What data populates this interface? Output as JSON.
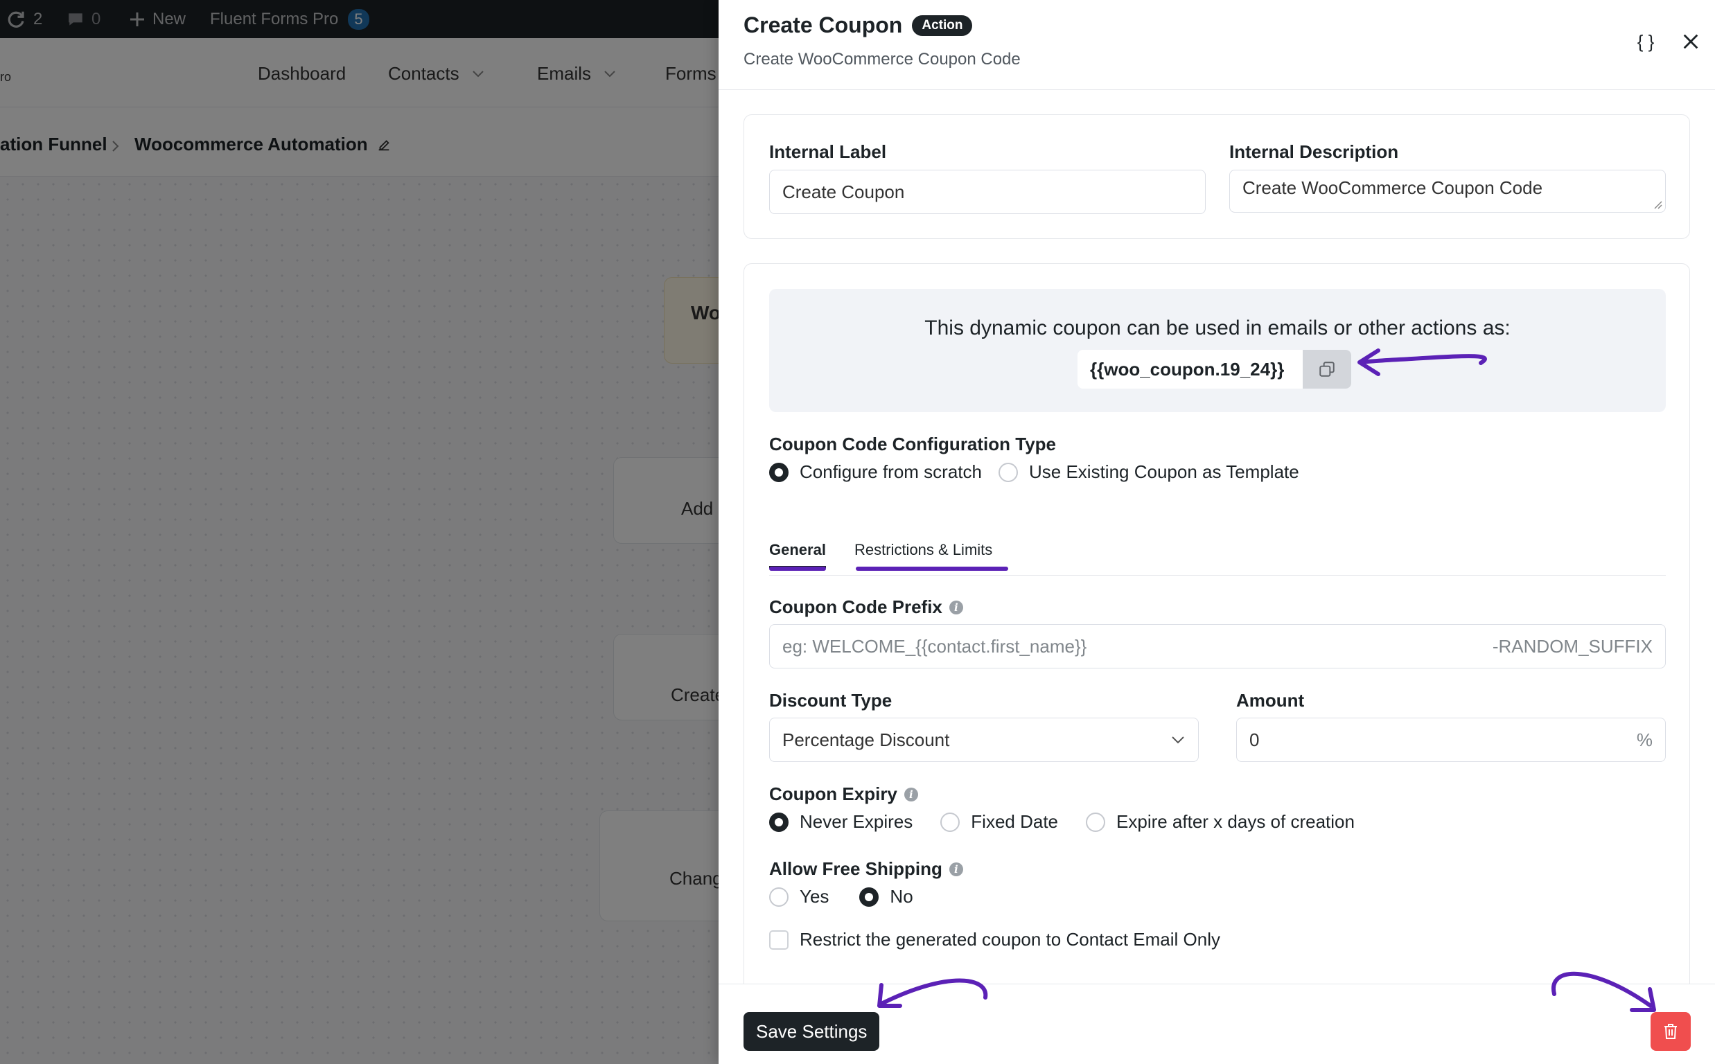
{
  "admin_bar": {
    "updates_count": "2",
    "comments_count": "0",
    "new_label": "New",
    "plugin_label": "Fluent Forms Pro",
    "plugin_badge": "5"
  },
  "top_nav": {
    "brand_fragment": "ro",
    "items": [
      "Dashboard",
      "Contacts",
      "Emails",
      "Forms"
    ]
  },
  "breadcrumb": {
    "parent": "ation Funnel",
    "current": "Woocommerce Automation"
  },
  "canvas": {
    "trigger_node": "Wo",
    "nodes": [
      "Add",
      "Create",
      "Chang"
    ]
  },
  "drawer": {
    "title": "Create Coupon",
    "badge": "Action",
    "subtitle": "Create WooCommerce Coupon Code",
    "code_button_label": "{ }",
    "label_section": {
      "internal_label_title": "Internal Label",
      "internal_label_value": "Create Coupon",
      "internal_description_title": "Internal Description",
      "internal_description_value": "Create WooCommerce Coupon Code"
    },
    "notice": {
      "text": "This dynamic coupon can be used in emails or other actions as:",
      "code": "{{woo_coupon.19_24}}"
    },
    "config_type": {
      "label": "Coupon Code Configuration Type",
      "options": [
        "Configure from scratch",
        "Use Existing Coupon as Template"
      ],
      "selected": "Configure from scratch"
    },
    "tabs": [
      "General",
      "Restrictions & Limits"
    ],
    "active_tab": "General",
    "prefix": {
      "label": "Coupon Code Prefix",
      "placeholder": "eg: WELCOME_{{contact.first_name}}",
      "suffix": "-RANDOM_SUFFIX"
    },
    "discount_type": {
      "label": "Discount Type",
      "value": "Percentage Discount"
    },
    "amount": {
      "label": "Amount",
      "value": "0",
      "unit": "%"
    },
    "expiry": {
      "label": "Coupon Expiry",
      "options": [
        "Never Expires",
        "Fixed Date",
        "Expire after x days of creation"
      ],
      "selected": "Never Expires"
    },
    "free_shipping": {
      "label": "Allow Free Shipping",
      "options": [
        "Yes",
        "No"
      ],
      "selected": "No"
    },
    "restrict_email": {
      "label": "Restrict the generated coupon to Contact Email Only",
      "checked": false
    },
    "save_label": "Save Settings"
  },
  "colors": {
    "annotation": "#5b21b6",
    "dark": "#1d2327",
    "danger": "#f04e4e"
  }
}
